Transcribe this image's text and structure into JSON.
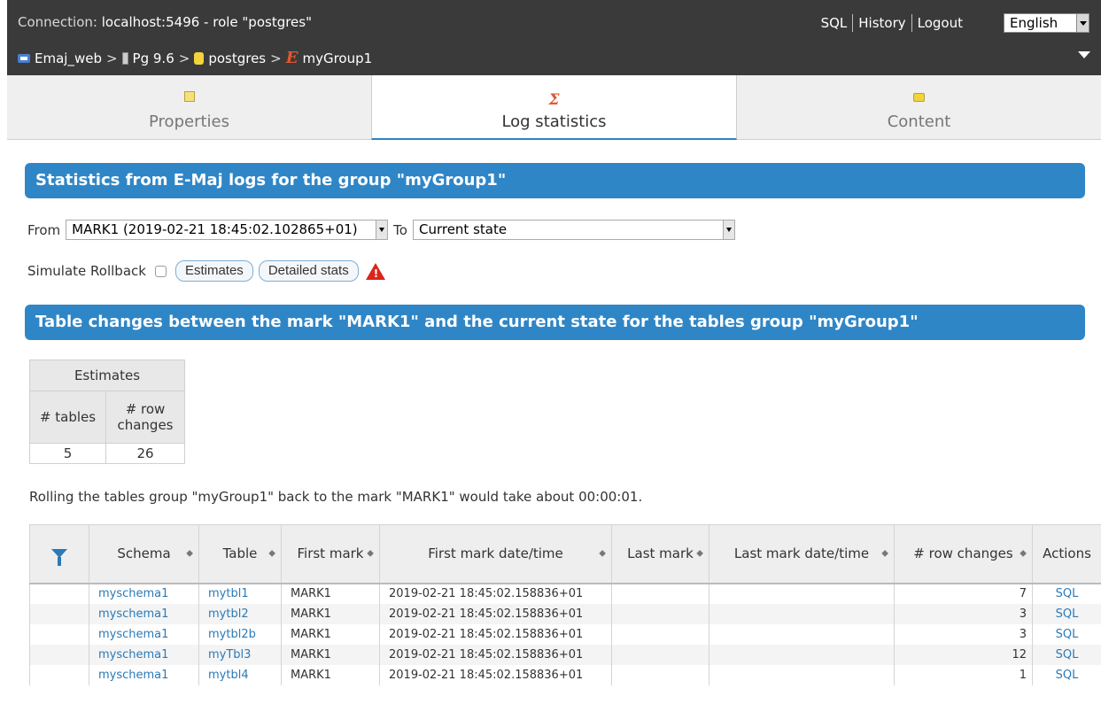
{
  "topbar": {
    "connection_label": "Connection:",
    "connection_value": "localhost:5496 - role \"postgres\"",
    "menu": [
      "SQL",
      "History",
      "Logout"
    ],
    "language": "English",
    "breadcrumb": {
      "app": "Emaj_web",
      "server": "Pg 9.6",
      "database": "postgres",
      "group": "myGroup1",
      "group_icon": "E"
    }
  },
  "tabs": [
    {
      "label": "Properties",
      "icon": "properties-icon"
    },
    {
      "label": "Log statistics",
      "icon": "sigma-icon",
      "icon_glyph": "Σ",
      "active": true
    },
    {
      "label": "Content",
      "icon": "folder-icon"
    }
  ],
  "stats_header": "Statistics from E-Maj logs for the group \"myGroup1\"",
  "filters": {
    "from_label": "From",
    "from_value": "MARK1 (2019-02-21 18:45:02.102865+01)",
    "to_label": "To",
    "to_value": "Current state",
    "simulate_label": "Simulate Rollback",
    "estimates_button": "Estimates",
    "detailed_button": "Detailed stats"
  },
  "changes_header": "Table changes between the mark \"MARK1\" and the current state for the tables group \"myGroup1\"",
  "estimates": {
    "title": "Estimates",
    "col_tables": "# tables",
    "col_rows": "# row changes",
    "tables": "5",
    "rows": "26"
  },
  "rollback_text": "Rolling the tables group \"myGroup1\" back to the mark \"MARK1\" would take about 00:00:01.",
  "table": {
    "headers": [
      "Schema",
      "Table",
      "First mark",
      "First mark date/time",
      "Last mark",
      "Last mark date/time",
      "# row changes",
      "Actions"
    ],
    "rows": [
      {
        "schema": "myschema1",
        "table": "mytbl1",
        "first_mark": "MARK1",
        "first_date": "2019-02-21 18:45:02.158836+01",
        "last_mark": "",
        "last_date": "",
        "changes": "7",
        "action": "SQL"
      },
      {
        "schema": "myschema1",
        "table": "mytbl2",
        "first_mark": "MARK1",
        "first_date": "2019-02-21 18:45:02.158836+01",
        "last_mark": "",
        "last_date": "",
        "changes": "3",
        "action": "SQL"
      },
      {
        "schema": "myschema1",
        "table": "mytbl2b",
        "first_mark": "MARK1",
        "first_date": "2019-02-21 18:45:02.158836+01",
        "last_mark": "",
        "last_date": "",
        "changes": "3",
        "action": "SQL"
      },
      {
        "schema": "myschema1",
        "table": "myTbl3",
        "first_mark": "MARK1",
        "first_date": "2019-02-21 18:45:02.158836+01",
        "last_mark": "",
        "last_date": "",
        "changes": "12",
        "action": "SQL"
      },
      {
        "schema": "myschema1",
        "table": "mytbl4",
        "first_mark": "MARK1",
        "first_date": "2019-02-21 18:45:02.158836+01",
        "last_mark": "",
        "last_date": "",
        "changes": "1",
        "action": "SQL"
      }
    ]
  },
  "colors": {
    "accent": "#2f86c7",
    "topbar": "#3a3a3a",
    "link": "#2a7ab8",
    "warning": "#d9261c"
  }
}
